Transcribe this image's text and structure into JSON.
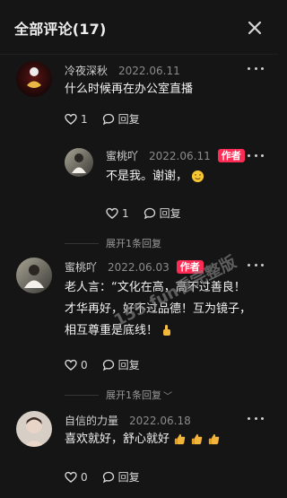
{
  "header": {
    "title": "全部评论(17)"
  },
  "comments": [
    {
      "author": "冷夜深秋",
      "date": "2022.06.11",
      "text": "什么时候再在办公室直播",
      "likes": "1",
      "reply_label": "回复",
      "expand_label": "展开1条回复"
    },
    {
      "author": "蜜桃吖",
      "date": "2022.06.11",
      "badge": "作者",
      "text": "不是我。谢谢，",
      "likes": "1",
      "reply_label": "回复",
      "expand_label": "展开1条回复"
    },
    {
      "author": "蜜桃吖",
      "date": "2022.06.03",
      "badge": "作者",
      "text": "老人言：“文化在高，高不过善良！才华再好，好不过品德！互为镜子，相互尊重是底线！",
      "likes": "0",
      "reply_label": "回复",
      "expand_label": "展开1条回复"
    },
    {
      "author": "自信的力量",
      "date": "2022.06.18",
      "text": "喜欢就好，舒心就好",
      "likes": "0",
      "reply_label": "回复"
    }
  ],
  "watermark": {
    "text": "155.fun看完整版"
  }
}
